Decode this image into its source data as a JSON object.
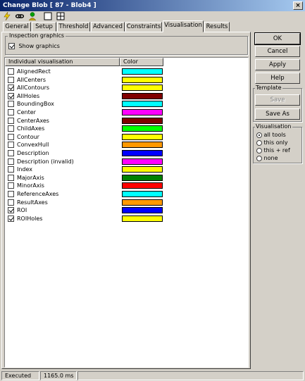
{
  "window": {
    "title": "Change Blob [ 87 - Blob4 ]",
    "close_label": "×"
  },
  "toolbar": {
    "icons": [
      "lightning-icon",
      "link-icon",
      "person-icon",
      "square-icon",
      "grid-icon"
    ]
  },
  "tabs": [
    {
      "label": "General"
    },
    {
      "label": "Setup"
    },
    {
      "label": "Threshold"
    },
    {
      "label": "Advanced"
    },
    {
      "label": "Constraints"
    },
    {
      "label": "Visualisation",
      "active": true
    },
    {
      "label": "Results"
    }
  ],
  "inspection": {
    "group_title": "Inspection graphics",
    "show_graphics_label": "Show graphics",
    "show_graphics_checked": true
  },
  "list": {
    "header_name": "Individual visualisation",
    "header_color": "Color",
    "rows": [
      {
        "name": "AlignedRect",
        "checked": false,
        "color": "#00ffff"
      },
      {
        "name": "AllCenters",
        "checked": false,
        "color": "#ffff00"
      },
      {
        "name": "AllContours",
        "checked": true,
        "color": "#ffff00"
      },
      {
        "name": "AllHoles",
        "checked": true,
        "color": "#800000"
      },
      {
        "name": "BoundingBox",
        "checked": false,
        "color": "#00ffff"
      },
      {
        "name": "Center",
        "checked": false,
        "color": "#ff00ff"
      },
      {
        "name": "CenterAxes",
        "checked": false,
        "color": "#800000"
      },
      {
        "name": "ChildAxes",
        "checked": false,
        "color": "#00ff00"
      },
      {
        "name": "Contour",
        "checked": false,
        "color": "#ffff00"
      },
      {
        "name": "ConvexHull",
        "checked": false,
        "color": "#ff9900"
      },
      {
        "name": "Description",
        "checked": false,
        "color": "#0000ff"
      },
      {
        "name": "Description (invalid)",
        "checked": false,
        "color": "#ff00ff"
      },
      {
        "name": "Index",
        "checked": false,
        "color": "#ffff00"
      },
      {
        "name": "MajorAxis",
        "checked": false,
        "color": "#008000"
      },
      {
        "name": "MinorAxis",
        "checked": false,
        "color": "#ff0000"
      },
      {
        "name": "ReferenceAxes",
        "checked": false,
        "color": "#00ffff"
      },
      {
        "name": "ResultAxes",
        "checked": false,
        "color": "#ff9900"
      },
      {
        "name": "ROI",
        "checked": true,
        "color": "#0000ff"
      },
      {
        "name": "ROIHoles",
        "checked": true,
        "color": "#ffff00"
      }
    ]
  },
  "buttons": {
    "ok": "OK",
    "cancel": "Cancel",
    "apply": "Apply",
    "help": "Help"
  },
  "template": {
    "group_title": "Template",
    "save": "Save",
    "save_as": "Save As"
  },
  "visualisation": {
    "group_title": "Visualisation",
    "options": [
      {
        "label": "all tools",
        "selected": true
      },
      {
        "label": "this only",
        "selected": false
      },
      {
        "label": "this + ref",
        "selected": false
      },
      {
        "label": "none",
        "selected": false
      }
    ]
  },
  "status": {
    "state": "Executed",
    "time": "1165.0 ms"
  }
}
